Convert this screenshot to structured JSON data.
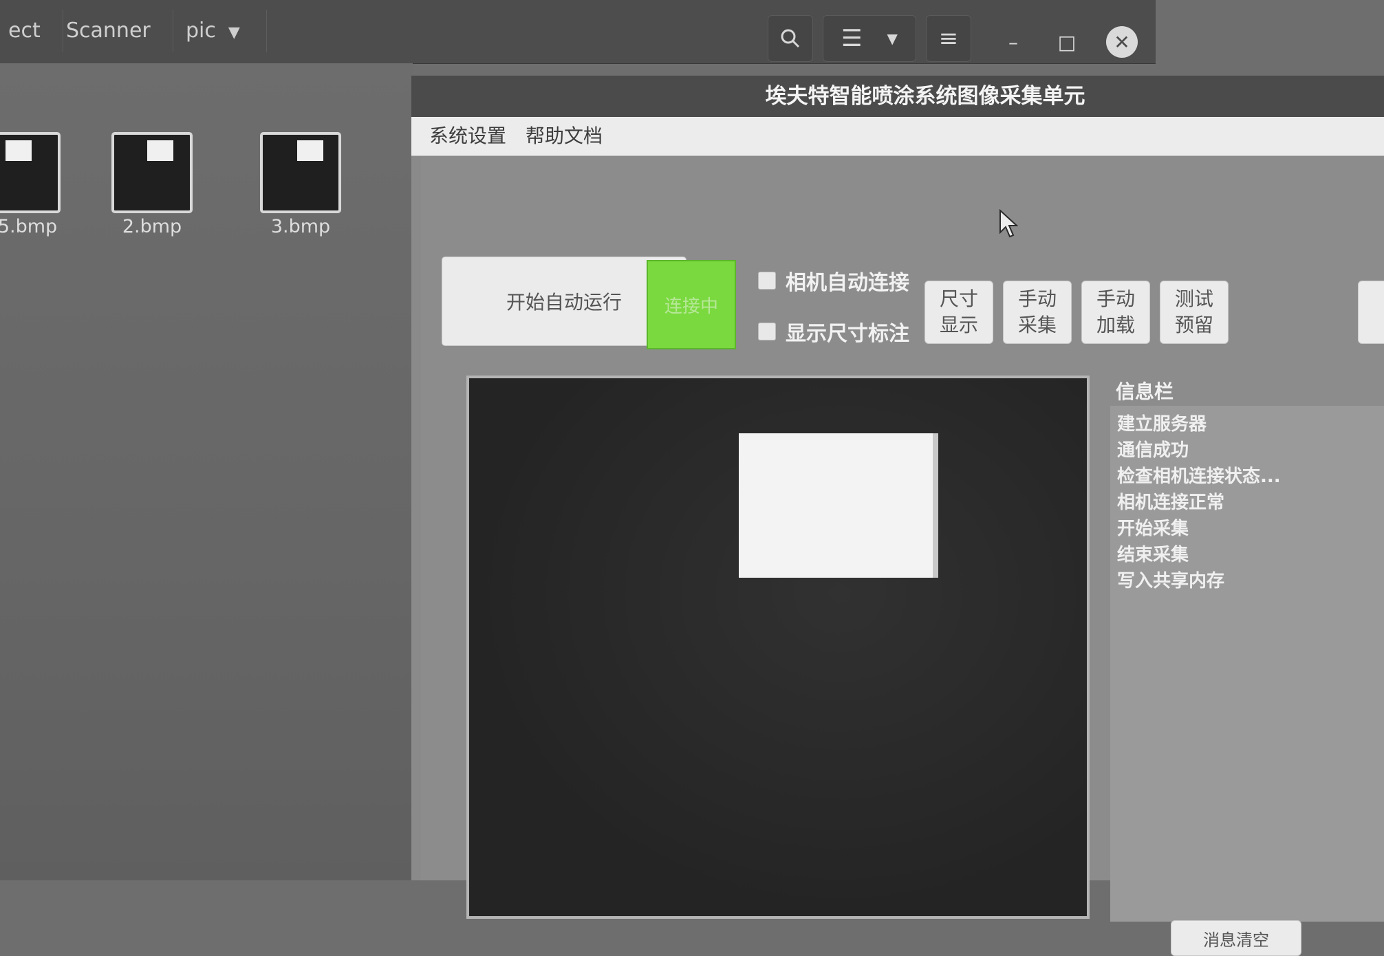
{
  "file_manager": {
    "breadcrumbs": [
      "ect",
      "Scanner",
      "pic"
    ],
    "files": [
      {
        "name": "5.bmp"
      },
      {
        "name": "2.bmp"
      },
      {
        "name": "3.bmp"
      }
    ],
    "icons": {
      "search": "search-icon",
      "view": "list-view-icon",
      "view_dropdown": "chevron-down-icon",
      "menu": "hamburger-menu-icon"
    }
  },
  "app": {
    "title": "埃夫特智能喷涂系统图像采集单元",
    "menu": [
      "系统设置",
      "帮助文档"
    ],
    "start_button": "开始自动运行",
    "connection_status": "连接中",
    "connection_color": "#7ad93f",
    "checkboxes": [
      {
        "label": "相机自动连接",
        "checked": false
      },
      {
        "label": "显示尺寸标注",
        "checked": false
      }
    ],
    "tool_buttons": [
      {
        "line1": "尺寸",
        "line2": "显示"
      },
      {
        "line1": "手动",
        "line2": "采集"
      },
      {
        "line1": "手动",
        "line2": "加载"
      },
      {
        "line1": "测试",
        "line2": "预留"
      }
    ],
    "info_panel": {
      "title": "信息栏",
      "messages": [
        "建立服务器",
        "通信成功",
        "检查相机连接状态...",
        "相机连接正常",
        "开始采集",
        "结束采集",
        "写入共享内存"
      ]
    },
    "clear_button": "消息清空"
  }
}
